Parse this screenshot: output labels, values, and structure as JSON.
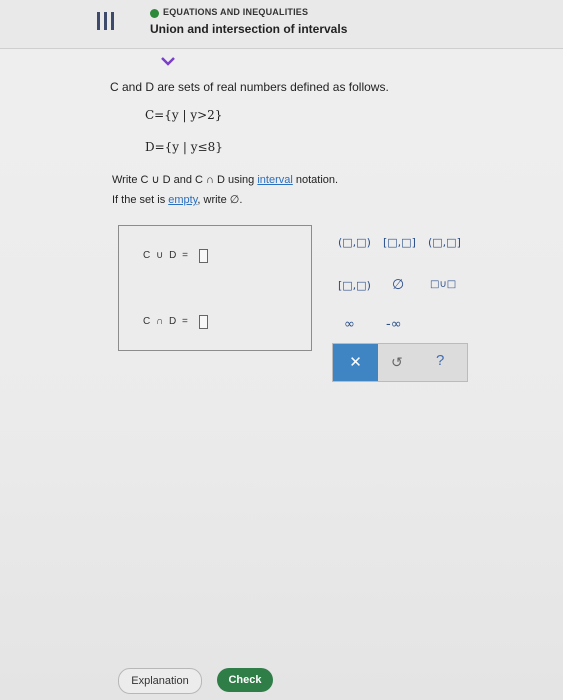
{
  "header": {
    "topic": "EQUATIONS AND INEQUALITIES",
    "title": "Union and intersection of intervals",
    "menu_icon": "hamburger-icon",
    "topic_icon": "status-dot-icon"
  },
  "problem": {
    "intro": "C and D are sets of real numbers defined as follows.",
    "set_c": "C={y | y>2}",
    "set_d": "D={y | y≤8}",
    "instruction_prefix": "Write C ∪ D and C ∩ D using ",
    "instruction_link": "interval",
    "instruction_suffix": " notation.",
    "empty_prefix": "If the set is ",
    "empty_link": "empty",
    "empty_suffix": ", write ∅."
  },
  "answers": {
    "union_label": "C ∪ D =",
    "intersection_label": "C ∩ D ="
  },
  "keypad": {
    "open_open": "(□,□)",
    "closed_closed": "[□,□]",
    "open_closed": "(□,□]",
    "closed_open": "[□,□)",
    "empty_set": "∅",
    "union": "□∪□",
    "infinity": "∞",
    "neg_infinity": "-∞",
    "clear": "✕",
    "undo": "↺",
    "help": "?"
  },
  "footer": {
    "explanation": "Explanation",
    "check": "Check"
  },
  "colors": {
    "accent_blue": "#3f85c4",
    "check_green": "#2f7d47",
    "link_blue": "#2a6fbf"
  }
}
